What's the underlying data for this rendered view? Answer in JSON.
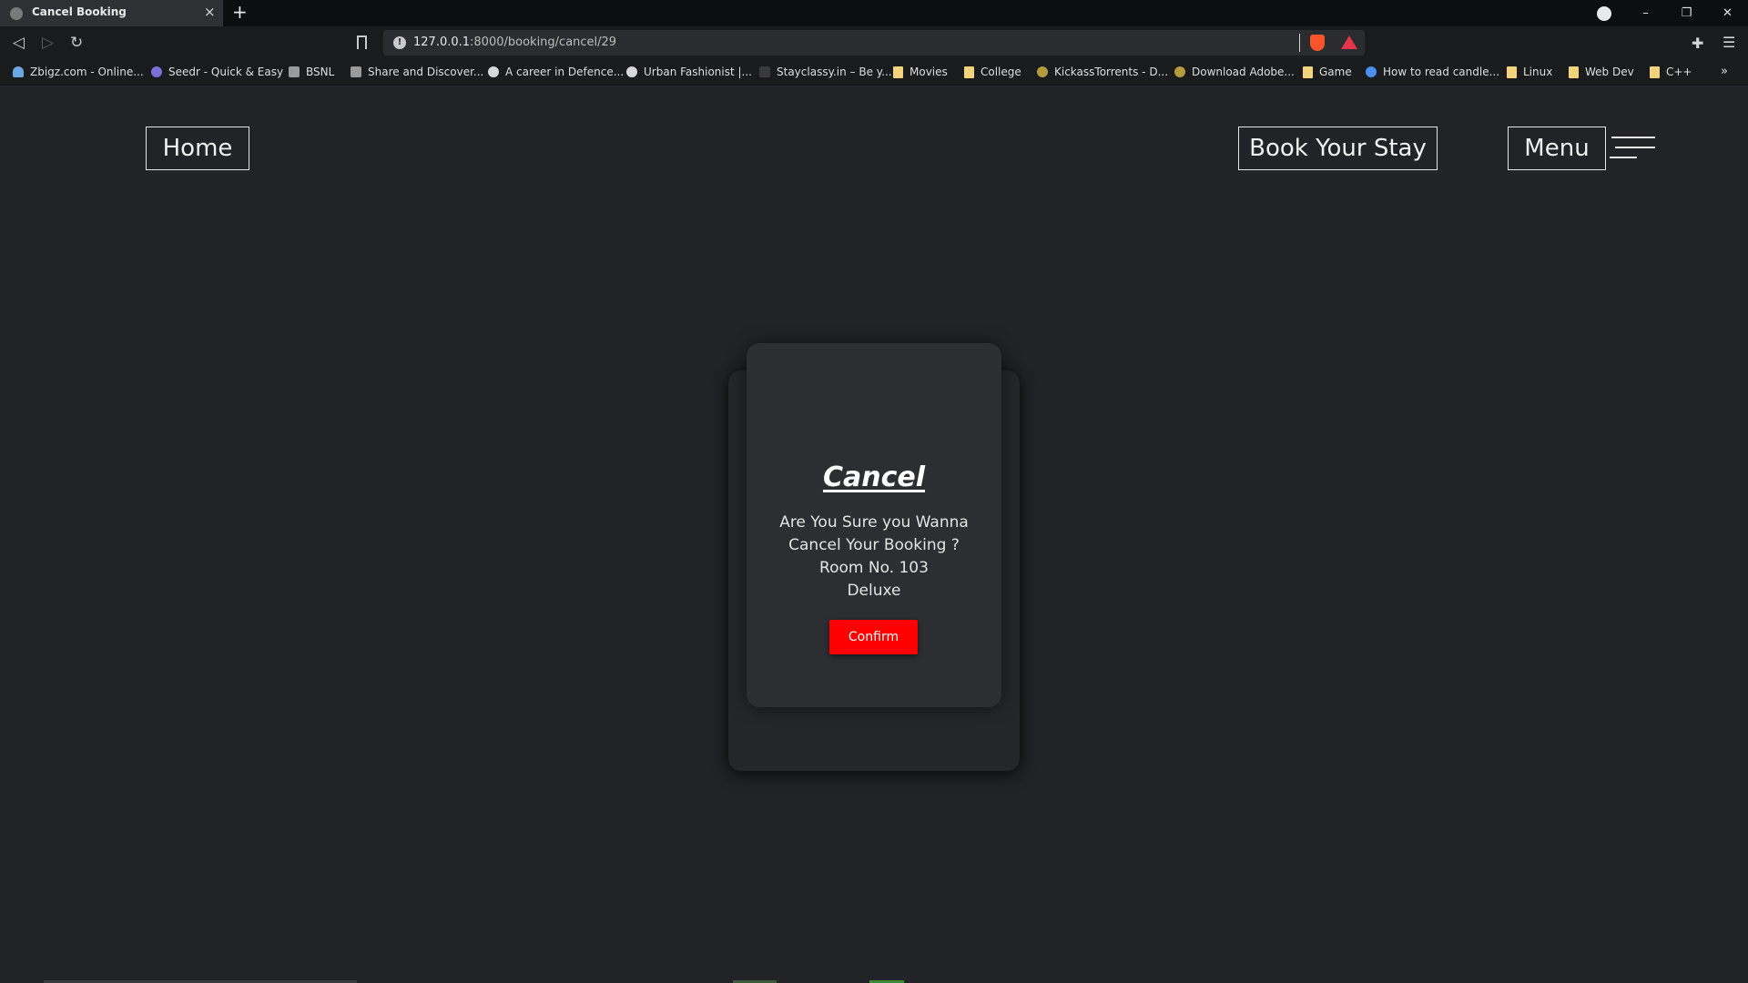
{
  "browser": {
    "tab_title": "Cancel Booking",
    "tab_close": "×",
    "new_tab": "+",
    "url_host": "127.0.0.1",
    "url_path": ":8000/booking/cancel/29",
    "window_controls": [
      "–",
      "❐",
      "✕"
    ],
    "bookmarks": [
      {
        "label": "Zbigz.com - Online...",
        "icon": "cloud-icon"
      },
      {
        "label": "Seedr - Quick & Easy",
        "icon": "seedr-icon"
      },
      {
        "label": "BSNL",
        "icon": "bsnl-icon"
      },
      {
        "label": "Share and Discover...",
        "icon": "share-icon"
      },
      {
        "label": "A career in Defence...",
        "icon": "globe-icon"
      },
      {
        "label": "Urban Fashionist |...",
        "icon": "globe-icon"
      },
      {
        "label": "Stayclassy.in – Be y...",
        "icon": "site-icon"
      },
      {
        "label": "Movies",
        "icon": "folder-icon"
      },
      {
        "label": "College",
        "icon": "folder-icon"
      },
      {
        "label": "KickassTorrents - D...",
        "icon": "kat-icon"
      },
      {
        "label": "Download Adobe...",
        "icon": "kat-icon"
      },
      {
        "label": "Game",
        "icon": "folder-icon"
      },
      {
        "label": "How to read candle...",
        "icon": "chrome-icon"
      },
      {
        "label": "Linux",
        "icon": "folder-icon"
      },
      {
        "label": "Web Dev",
        "icon": "folder-icon"
      },
      {
        "label": "C++",
        "icon": "folder-icon"
      }
    ],
    "bookmarks_more": "»"
  },
  "nav": {
    "home": "Home",
    "book": "Book Your Stay",
    "menu": "Menu"
  },
  "card": {
    "title": "Cancel",
    "line1": "Are You Sure you Wanna",
    "line2": "Cancel Your Booking ?",
    "line3": "Room No. 103",
    "line4": "Deluxe",
    "confirm": "Confirm"
  },
  "colors": {
    "page_bg": "#222327",
    "card_bg": "#2d2e32",
    "confirm_bg": "#ff0000"
  }
}
